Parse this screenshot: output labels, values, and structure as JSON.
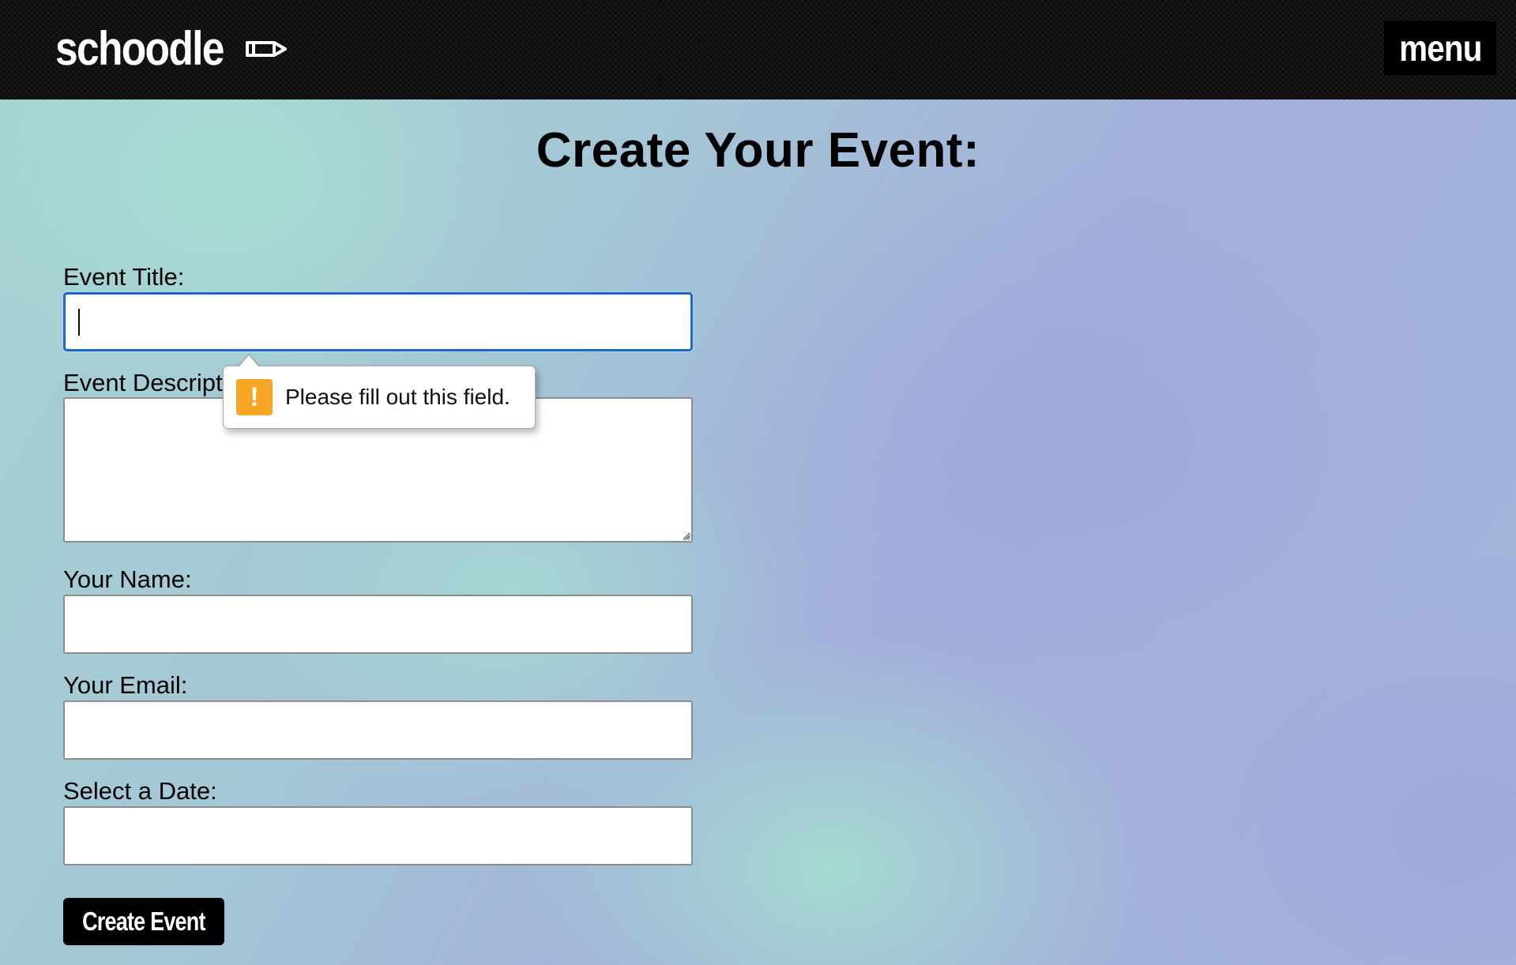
{
  "header": {
    "logo_text": "schoodle",
    "logo_icon": "pencil-icon",
    "menu_label": "menu"
  },
  "page": {
    "title": "Create Your Event:"
  },
  "form": {
    "event_title": {
      "label": "Event Title:",
      "value": ""
    },
    "event_description": {
      "label": "Event Description:",
      "value": ""
    },
    "your_name": {
      "label": "Your Name:",
      "value": ""
    },
    "your_email": {
      "label": "Your Email:",
      "value": ""
    },
    "date": {
      "label": "Select a Date:",
      "value": ""
    },
    "submit_label": "Create Event"
  },
  "validation": {
    "message": "Please fill out this field.",
    "icon": "warning-icon",
    "icon_glyph": "!",
    "icon_color": "#f6a623"
  },
  "colors": {
    "header_bg": "#0b0b0b",
    "focus_ring": "#1a68c7"
  }
}
